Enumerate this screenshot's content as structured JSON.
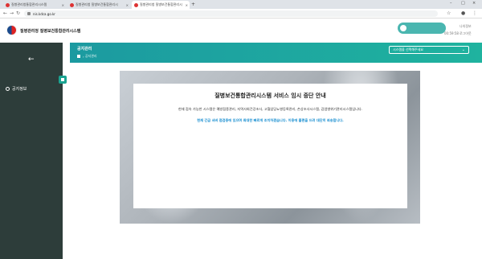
{
  "browser": {
    "tabs": [
      {
        "label": "질병관리청통합관리시스템",
        "active": false,
        "favicon_color": "#d33"
      },
      {
        "label": "질병관리청 질병보건통합관리시",
        "active": false,
        "favicon_color": "#d33"
      },
      {
        "label": "질병관리청 질병보건통합관리시",
        "active": true,
        "favicon_color": "#d33"
      }
    ],
    "new_tab": "+",
    "url": "nis.kdca.go.kr",
    "window_controls": [
      "–",
      "□",
      "×"
    ]
  },
  "header": {
    "site_title": "질병관리청 질병보건통합관리시스템",
    "buttons": [
      "나의정보",
      "로그아웃"
    ],
    "timer": "00:59:58"
  },
  "sidebar": {
    "back": "←",
    "items": [
      {
        "label": "공지정보"
      }
    ]
  },
  "main": {
    "page_title": "공지관리",
    "breadcrumb_current": "공지관리",
    "system_select": "시스템을 선택해주세요"
  },
  "notice": {
    "title": "질병보건통합관리시스템 서비스 임시 중단 안내",
    "body": "현재 접속 가능한 시스템은 예방접종관리, 지역사회건강조사, 고혈압당뇨병등록관리, 손상조사시스템, 감염병위기관리시스템입니다.",
    "emphasis": "현재 긴급 서버 점검중에 있으며 최대한 빠르게 조치하겠습니다. 이용에 불편을 드려 대단히 죄송합니다."
  },
  "colors": {
    "teal_header": "#1fb39f",
    "sidebar_bg": "#2d3d3a",
    "notice_emphasis": "#1a8fd1"
  }
}
